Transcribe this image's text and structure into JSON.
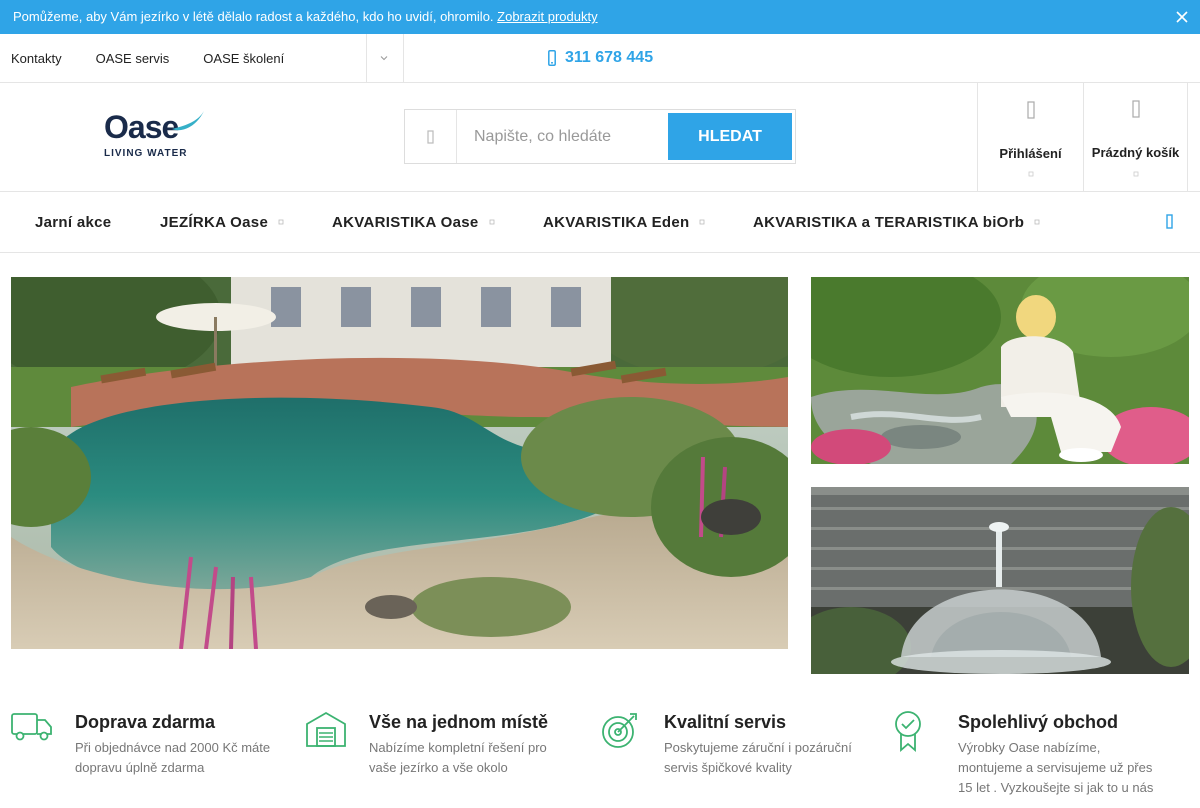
{
  "promo": {
    "text": "Pomůžeme, aby Vám jezírko v létě dělalo radost a každého, kdo ho uvidí, ohromilo.",
    "link": "Zobrazit produkty"
  },
  "toplinks": [
    "Kontakty",
    "OASE servis",
    "OASE školení"
  ],
  "phone": "311 678 445",
  "logo": {
    "word": "Oase",
    "tagline": "LIVING WATER"
  },
  "search": {
    "placeholder": "Napište, co hledáte",
    "button": "HLEDAT"
  },
  "login_label": "Přihlášení",
  "cart_label": "Prázdný košík",
  "nav": [
    {
      "label": "Jarní akce",
      "has_sub": false
    },
    {
      "label": "JEZÍRKA Oase",
      "has_sub": true
    },
    {
      "label": "AKVARISTIKA Oase",
      "has_sub": true
    },
    {
      "label": "AKVARISTIKA Eden",
      "has_sub": true
    },
    {
      "label": "AKVARISTIKA a TERARISTIKA biOrb",
      "has_sub": true
    }
  ],
  "features": [
    {
      "title": "Doprava zdarma",
      "text": "Při objednávce nad 2000 Kč máte dopravu úplně zdarma",
      "icon": "truck-icon"
    },
    {
      "title": "Vše na jednom místě",
      "text": "Nabízíme kompletní řešení pro vaše jezírko a vše okolo",
      "icon": "warehouse-icon"
    },
    {
      "title": "Kvalitní servis",
      "text": "Poskytujeme záruční i pozáruční servis špičkové kvality",
      "icon": "target-icon"
    },
    {
      "title": "Spolehlivý obchod",
      "text": "Výrobky Oase nabízíme, montujeme a servisujeme už přes 15 let . Vyzkoušejte si jak to u nás",
      "icon": "award-icon"
    }
  ],
  "colors": {
    "accent": "#2fa4e7",
    "icon_green": "#3cb371"
  }
}
